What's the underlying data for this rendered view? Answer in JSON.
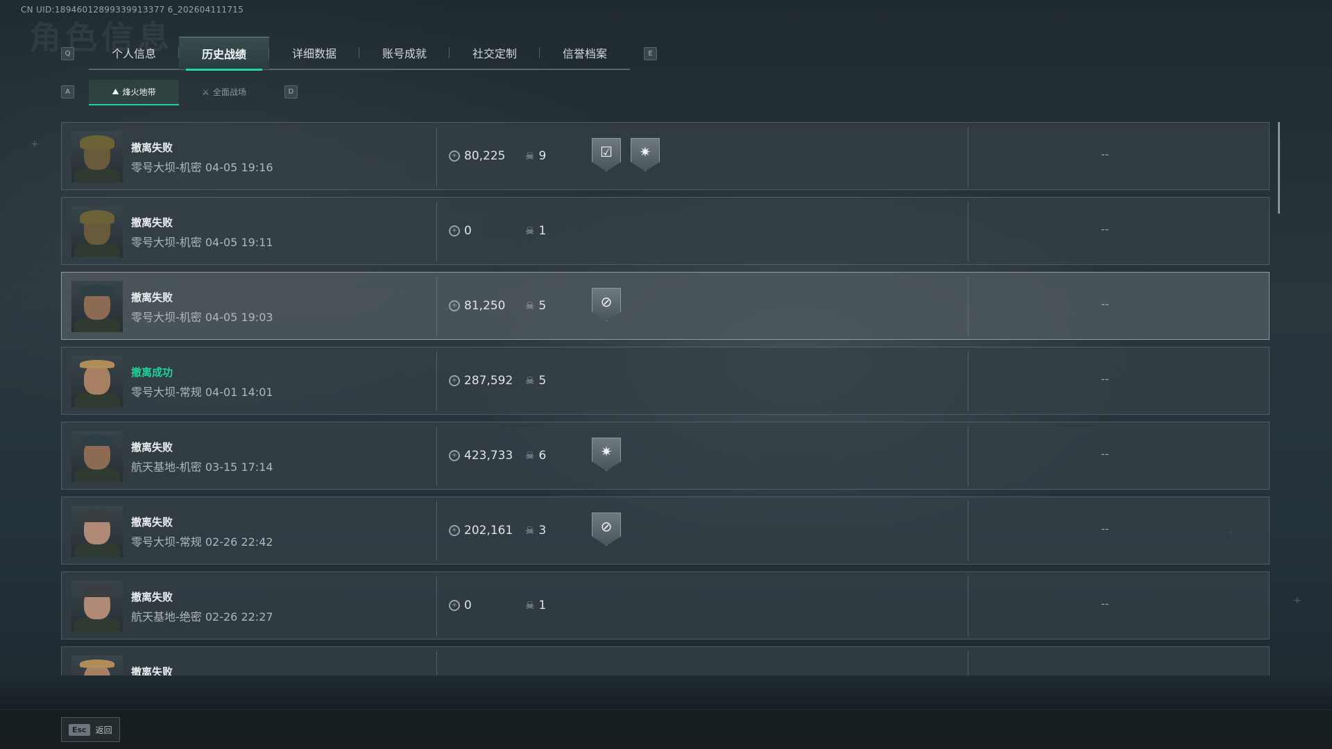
{
  "uid": "CN UID:18946012899339913377 6_202604111715",
  "background_title": "角色信息",
  "keys": {
    "prev_tab": "Q",
    "next_tab": "E",
    "prev_sub": "A",
    "next_sub": "D"
  },
  "tabs": [
    {
      "label": "个人信息"
    },
    {
      "label": "历史战绩",
      "active": true
    },
    {
      "label": "详细数据"
    },
    {
      "label": "账号成就"
    },
    {
      "label": "社交定制"
    },
    {
      "label": "信誉档案"
    }
  ],
  "subtabs": [
    {
      "label": "烽火地带",
      "icon": "⛰",
      "active": true
    },
    {
      "label": "全面战场",
      "icon": "⚔"
    }
  ],
  "matches": [
    {
      "result": "撤离失败",
      "success": false,
      "map": "零号大坝-机密 04-05 19:16",
      "value": "80,225",
      "kills": "9",
      "badges": [
        "shield-check-badge",
        "burst-badge"
      ],
      "placeholder": "--",
      "avatar": "a"
    },
    {
      "result": "撤离失败",
      "success": false,
      "map": "零号大坝-机密 04-05 19:11",
      "value": "0",
      "kills": "1",
      "badges": [],
      "placeholder": "--",
      "avatar": "a"
    },
    {
      "result": "撤离失败",
      "success": false,
      "map": "零号大坝-机密 04-05 19:03",
      "value": "81,250",
      "kills": "5",
      "badges": [
        "target-badge"
      ],
      "placeholder": "--",
      "avatar": "b",
      "highlight": true
    },
    {
      "result": "撤离成功",
      "success": true,
      "map": "零号大坝-常规 04-01 14:01",
      "value": "287,592",
      "kills": "5",
      "badges": [],
      "placeholder": "--",
      "avatar": "c"
    },
    {
      "result": "撤离失败",
      "success": false,
      "map": "航天基地-机密 03-15 17:14",
      "value": "423,733",
      "kills": "6",
      "badges": [
        "burst-badge"
      ],
      "placeholder": "--",
      "avatar": "b"
    },
    {
      "result": "撤离失败",
      "success": false,
      "map": "零号大坝-常规 02-26 22:42",
      "value": "202,161",
      "kills": "3",
      "badges": [
        "target-badge"
      ],
      "placeholder": "--",
      "avatar": "d"
    },
    {
      "result": "撤离失败",
      "success": false,
      "map": "航天基地-绝密 02-26 22:27",
      "value": "0",
      "kills": "1",
      "badges": [],
      "placeholder": "--",
      "avatar": "d"
    },
    {
      "result": "撤离失败",
      "success": false,
      "map": "",
      "value": "",
      "kills": "",
      "badges": [],
      "placeholder": "--",
      "avatar": "c"
    }
  ],
  "footer": {
    "esc_key": "Esc",
    "back_label": "返回"
  },
  "colors": {
    "accent": "#1fd4a6",
    "success": "#1fd49a"
  }
}
